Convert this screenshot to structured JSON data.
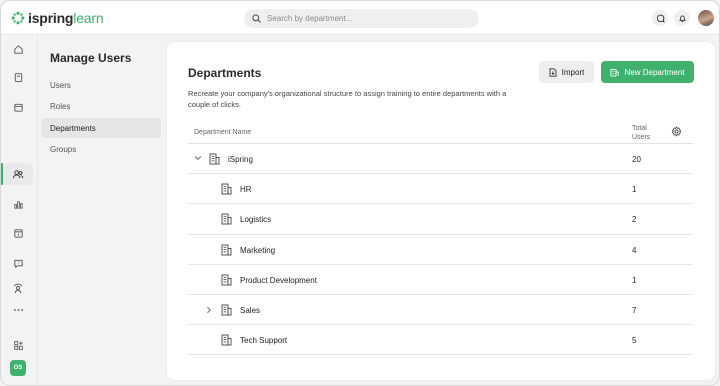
{
  "app": {
    "logo_main": "ispring",
    "logo_accent": "learn"
  },
  "search": {
    "placeholder": "Search by department..."
  },
  "rail": {
    "items": [
      "home-icon",
      "book-icon",
      "calendar-icon",
      "users-icon",
      "reports-icon",
      "assignments-icon",
      "quiz-icon",
      "user-broadcast-icon",
      "more-icon"
    ],
    "apps_icon": "add-apps-icon",
    "account_badge": "OS"
  },
  "subnav": {
    "title": "Manage Users",
    "items": [
      "Users",
      "Roles",
      "Departments",
      "Groups"
    ],
    "active": "Departments"
  },
  "page": {
    "title": "Departments",
    "description": "Recreate your company's organizational structure to assign training to entire departments with a couple of clicks.",
    "import_label": "Import",
    "new_department_label": "New Department"
  },
  "table": {
    "col_name": "Department Name",
    "col_total_line1": "Total",
    "col_total_line2": "Users",
    "rows": [
      {
        "name": "iSpring",
        "count": "20",
        "level": 0,
        "expander": "expanded"
      },
      {
        "name": "HR",
        "count": "1",
        "level": 1,
        "expander": "none"
      },
      {
        "name": "Logistics",
        "count": "2",
        "level": 1,
        "expander": "none"
      },
      {
        "name": "Marketing",
        "count": "4",
        "level": 1,
        "expander": "none"
      },
      {
        "name": "Product Development",
        "count": "1",
        "level": 1,
        "expander": "none"
      },
      {
        "name": "Sales",
        "count": "7",
        "level": 1,
        "expander": "collapsed"
      },
      {
        "name": "Tech Support",
        "count": "5",
        "level": 1,
        "expander": "none"
      }
    ]
  },
  "colors": {
    "accent": "#3fb16c",
    "text": "#222222",
    "muted": "#666666"
  }
}
